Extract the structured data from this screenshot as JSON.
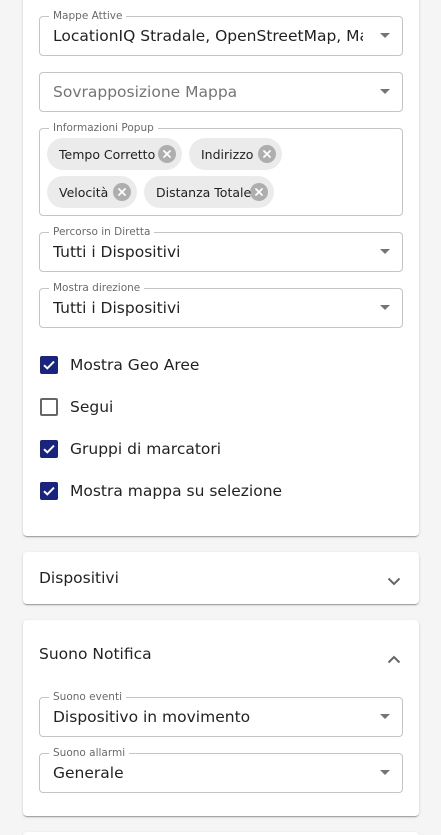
{
  "settings": {
    "active_maps": {
      "label": "Mappe Attive",
      "value": "LocationIQ Stradale, OpenStreetMap, Mappe di Google"
    },
    "map_overlay": {
      "placeholder": "Sovrapposizione Mappa"
    },
    "popup_info": {
      "label": "Informazioni Popup",
      "chips": [
        "Tempo Corretto",
        "Indirizzo",
        "Velocità",
        "Distanza Totale"
      ]
    },
    "live_route": {
      "label": "Percorso in Diretta",
      "value": "Tutti i Dispositivi"
    },
    "show_direction": {
      "label": "Mostra direzione",
      "value": "Tutti i Dispositivi"
    },
    "checkboxes": [
      {
        "label": "Mostra Geo Aree",
        "checked": true
      },
      {
        "label": "Segui",
        "checked": false
      },
      {
        "label": "Gruppi di marcatori",
        "checked": true
      },
      {
        "label": "Mostra mappa su selezione",
        "checked": true
      }
    ]
  },
  "devices": {
    "title": "Dispositivi",
    "icon": "chevron-down-icon"
  },
  "notification_sound": {
    "title": "Suono Notifica",
    "icon": "chevron-up-icon",
    "event_sound": {
      "label": "Suono eventi",
      "value": "Dispositivo in movimento"
    },
    "alarm_sound": {
      "label": "Suono allarmi",
      "value": "Generale"
    }
  },
  "colors": {
    "accent": "#1a237e",
    "background": "#f5f5f5",
    "card": "#ffffff"
  }
}
